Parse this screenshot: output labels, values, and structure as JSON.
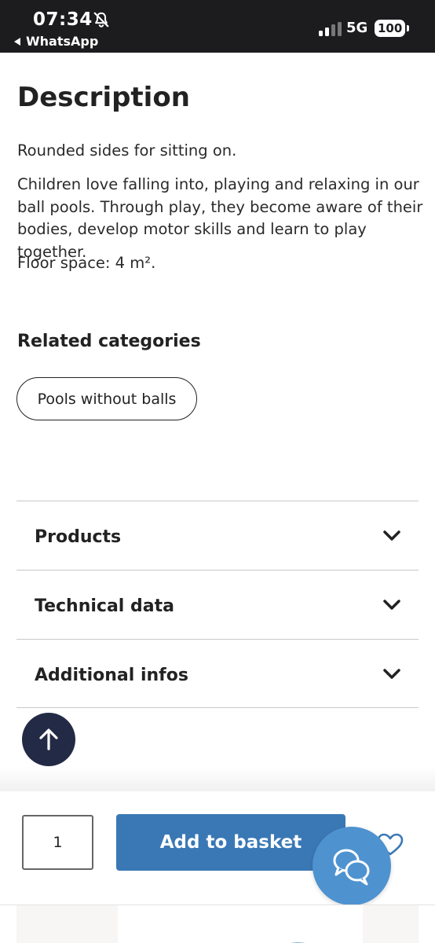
{
  "status_bar": {
    "time": "07:34",
    "back_app": "WhatsApp",
    "network": "5G",
    "battery": "100"
  },
  "description": {
    "title": "Description",
    "paragraphs": [
      "Rounded sides for sitting on.",
      "Children love falling into, playing and relaxing in our ball pools. Through play, they become aware of their bodies, develop motor skills and learn to play together.",
      "Floor space: 4 m²."
    ]
  },
  "related": {
    "title": "Related categories",
    "chips": [
      "Pools without balls"
    ]
  },
  "accordion": {
    "items": [
      {
        "label": "Products"
      },
      {
        "label": "Technical data"
      },
      {
        "label": "Additional infos"
      }
    ]
  },
  "purchase_bar": {
    "quantity": "1",
    "add_to_basket_label": "Add to basket"
  },
  "icons": {
    "bell": "bell-slash-icon",
    "scroll_top": "arrow-up-icon",
    "chevron": "chevron-down-icon",
    "wishlist": "heart-icon",
    "chat": "chat-bubbles-icon"
  },
  "colors": {
    "status_bar_bg": "#1c1c1e",
    "primary_button": "#3a78b5",
    "chat_button": "#4e93d0",
    "scroll_top_button": "#232a45",
    "text": "#222222"
  }
}
